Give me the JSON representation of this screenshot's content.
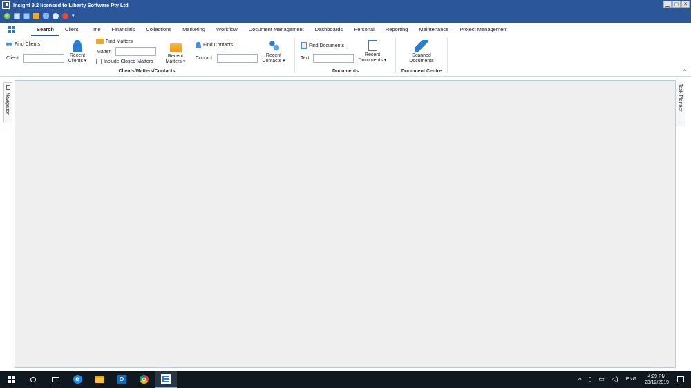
{
  "window": {
    "title": "Insight 9.2 licensed to Liberty Software Pty Ltd",
    "controls": [
      "▁",
      "▢",
      "✕"
    ]
  },
  "quick_access": {
    "overflow_label": "▾"
  },
  "tabs": [
    {
      "label": "Search"
    },
    {
      "label": "Client"
    },
    {
      "label": "Time"
    },
    {
      "label": "Financials"
    },
    {
      "label": "Collections"
    },
    {
      "label": "Marketing"
    },
    {
      "label": "Workflow"
    },
    {
      "label": "Document Management"
    },
    {
      "label": "Dashboards"
    },
    {
      "label": "Personal"
    },
    {
      "label": "Reporting"
    },
    {
      "label": "Maintenance"
    },
    {
      "label": "Project Management"
    }
  ],
  "active_tab": "Search",
  "ribbon": {
    "find_clients": "Find Clients",
    "client_label": "Client:",
    "client_value": "",
    "recent_clients": [
      "Recent",
      "Clients ▾"
    ],
    "find_matters": "Find Matters",
    "matter_label": "Matter:",
    "matter_value": "",
    "include_closed": "Include Closed Matters",
    "recent_matters": [
      "Recent",
      "Matters ▾"
    ],
    "find_contacts": "Find Contacts",
    "contact_label": "Contact:",
    "contact_value": "",
    "recent_contacts": [
      "Recent",
      "Contacts ▾"
    ],
    "group_clients": "Clients/Matters/Contacts",
    "find_documents": "Find Documents",
    "text_label": "Text:",
    "text_value": "",
    "recent_documents": [
      "Recent",
      "Documents ▾"
    ],
    "group_documents": "Documents",
    "scanned_documents": [
      "Scanned",
      "Documents"
    ],
    "group_document_centre": "Document Centre",
    "collapse": "^"
  },
  "side_panels": {
    "navigation": "Navigation",
    "task_planner": "Task Planner"
  },
  "taskbar": {
    "tray_language": "ENG",
    "time": "4:29 PM",
    "date": "23/12/2019"
  }
}
